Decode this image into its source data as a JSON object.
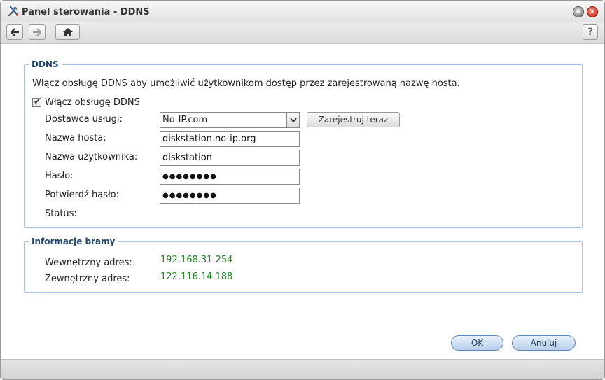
{
  "window": {
    "title": "Panel sterowania - DDNS",
    "icon": "tools-icon",
    "help_label": "?"
  },
  "ddns": {
    "legend": "DDNS",
    "description": "Włącz obsługę DDNS aby umożliwić użytkownikom dostęp przez zarejestrowaną nazwę hosta.",
    "enable_label": "Włącz obsługę DDNS",
    "enable_checked": true,
    "provider_label": "Dostawca usługi:",
    "provider_value": "No-IP.com",
    "register_label": "Zarejestruj teraz",
    "hostname_label": "Nazwa hosta:",
    "hostname_value": "diskstation.no-ip.org",
    "username_label": "Nazwa użytkownika:",
    "username_value": "diskstation",
    "password_label": "Hasło:",
    "password_value": "●●●●●●●●",
    "confirm_label": "Potwierdź hasło:",
    "confirm_value": "●●●●●●●●",
    "status_label": "Status:"
  },
  "gateway": {
    "legend": "Informacje bramy",
    "internal_label": "Wewnętrzny adres:",
    "internal_value": "192.168.31.254",
    "external_label": "Zewnętrzny adres:",
    "external_value": "122.116.14.188"
  },
  "footer": {
    "ok_label": "OK",
    "cancel_label": "Anuluj"
  },
  "colors": {
    "accent": "#23466e",
    "value_green": "#1f8a1f",
    "close_red": "#c6180c"
  }
}
